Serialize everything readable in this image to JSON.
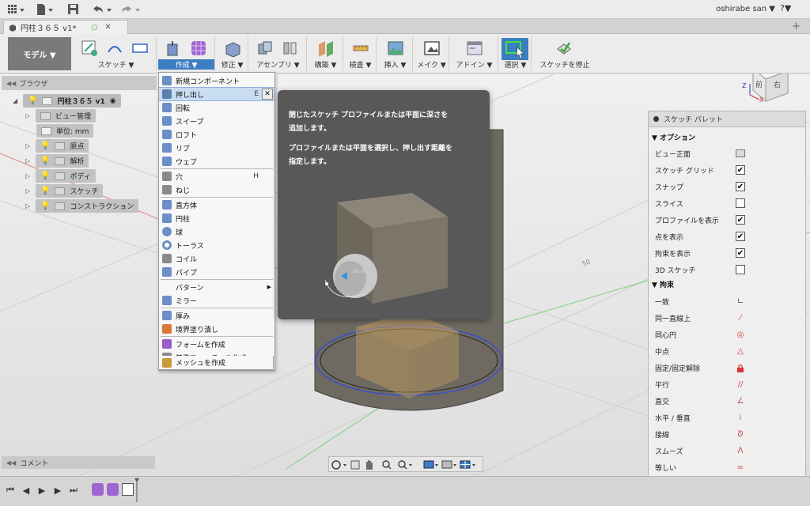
{
  "topbar": {
    "user": "oshirabe san ▼",
    "help": "?▼"
  },
  "tab": {
    "title": "円柱３６５ v1*",
    "modified_mark": "○",
    "close": "✕",
    "plus": "+"
  },
  "toolbar": {
    "workspace": "モデル ▼",
    "groups": [
      {
        "label": "スケッチ ▼"
      },
      {
        "label": "作成 ▼"
      },
      {
        "label": "修正 ▼"
      },
      {
        "label": "アセンブリ ▼"
      },
      {
        "label": "構築 ▼"
      },
      {
        "label": "検査 ▼"
      },
      {
        "label": "挿入 ▼"
      },
      {
        "label": "メイク ▼"
      },
      {
        "label": "アドイン ▼"
      },
      {
        "label": "選択 ▼"
      },
      {
        "label": "スケッチを停止"
      }
    ]
  },
  "browser": {
    "header": "ブラウザ",
    "root": "円柱３６５ v1",
    "items": [
      {
        "label": "ビュー管理"
      },
      {
        "label": "単位: mm"
      },
      {
        "label": "原点"
      },
      {
        "label": "解析"
      },
      {
        "label": "ボディ"
      },
      {
        "label": "スケッチ"
      },
      {
        "label": "コンストラクション"
      }
    ]
  },
  "create_menu": {
    "items": [
      {
        "label": "新規コンポーネント",
        "shortcut": "",
        "color": "#6b8fc7"
      },
      {
        "label": "押し出し",
        "shortcut": "E",
        "color": "#5c7fb0"
      },
      {
        "label": "回転",
        "shortcut": "",
        "color": "#6b8fc7"
      },
      {
        "label": "スイープ",
        "shortcut": "",
        "color": "#6b8fc7"
      },
      {
        "label": "ロフト",
        "shortcut": "",
        "color": "#6b8fc7"
      },
      {
        "label": "リブ",
        "shortcut": "",
        "color": "#6b8fc7"
      },
      {
        "label": "ウェブ",
        "shortcut": "",
        "color": "#6b8fc7"
      },
      {
        "label": "穴",
        "shortcut": "H",
        "color": "#8a8a8a"
      },
      {
        "label": "ねじ",
        "shortcut": "",
        "color": "#8a8a8a"
      },
      {
        "label": "直方体",
        "shortcut": "",
        "color": "#6b8fc7"
      },
      {
        "label": "円柱",
        "shortcut": "",
        "color": "#6b8fc7"
      },
      {
        "label": "球",
        "shortcut": "",
        "color": "#6b8fc7"
      },
      {
        "label": "トーラス",
        "shortcut": "",
        "color": "#6b8fc7"
      },
      {
        "label": "コイル",
        "shortcut": "",
        "color": "#8a8a8a"
      },
      {
        "label": "パイプ",
        "shortcut": "",
        "color": "#6b8fc7"
      },
      {
        "label": "パターン",
        "shortcut": "▶",
        "color": ""
      },
      {
        "label": "ミラー",
        "shortcut": "",
        "color": "#6b8fc7"
      },
      {
        "label": "厚み",
        "shortcut": "",
        "color": "#6b8fc7"
      },
      {
        "label": "境界塗り潰し",
        "shortcut": "",
        "color": "#d9763a"
      },
      {
        "label": "フォームを作成",
        "shortcut": "",
        "color": "#9a5cc7"
      },
      {
        "label": "基準フィーチャを作成",
        "shortcut": "",
        "color": "#8a8a8a"
      },
      {
        "label": "メッシュを作成",
        "shortcut": "",
        "color": "#c79a3a"
      }
    ],
    "close_icon": "✕"
  },
  "tooltip": {
    "line1": "閉じたスケッチ プロファイルまたは平面に深さを",
    "line2": "追加します。",
    "line3": "プロファイルまたは平面を選択し、押し出す距離を",
    "line4": "指定します。",
    "dim_value": "10.00"
  },
  "palette": {
    "title": "スケッチ パレット",
    "options_header": "▼ オプション",
    "options": [
      {
        "label": "ビュー正面",
        "control": "icon",
        "checked": false
      },
      {
        "label": "スケッチ グリッド",
        "control": "checkbox",
        "checked": true
      },
      {
        "label": "スナップ",
        "control": "checkbox",
        "checked": true
      },
      {
        "label": "スライス",
        "control": "checkbox",
        "checked": false
      },
      {
        "label": "プロファイルを表示",
        "control": "checkbox",
        "checked": true
      },
      {
        "label": "点を表示",
        "control": "checkbox",
        "checked": true
      },
      {
        "label": "拘束を表示",
        "control": "checkbox",
        "checked": true
      },
      {
        "label": "3D スケッチ",
        "control": "checkbox",
        "checked": false
      }
    ],
    "constraints_header": "▼ 拘束",
    "constraints": [
      {
        "label": "一致",
        "glyph": "∟",
        "color": "#555"
      },
      {
        "label": "同一直線上",
        "glyph": "⁄",
        "color": "#c44"
      },
      {
        "label": "同心円",
        "glyph": "◎",
        "color": "#d33"
      },
      {
        "label": "中点",
        "glyph": "△",
        "color": "#d33"
      },
      {
        "label": "固定/固定解除",
        "glyph": "🔒",
        "color": "#d33"
      },
      {
        "label": "平行",
        "glyph": "//",
        "color": "#c44"
      },
      {
        "label": "直交",
        "glyph": "∠",
        "color": "#c44"
      },
      {
        "label": "水平 / 垂直",
        "glyph": "⁞",
        "color": "#c44"
      },
      {
        "label": "接線",
        "glyph": "ᘐ",
        "color": "#c44"
      },
      {
        "label": "スムーズ",
        "glyph": "ⴷ",
        "color": "#c44"
      },
      {
        "label": "等しい",
        "glyph": "=",
        "color": "#d33"
      },
      {
        "label": "対称",
        "glyph": "[:]",
        "color": "#c44"
      }
    ]
  },
  "comment": {
    "label": "コメント"
  },
  "viewcube": {
    "top": "上",
    "front": "前",
    "right": "右",
    "axis_z": "Z",
    "axis_x": "X"
  },
  "viewport": {
    "label_50": "50"
  }
}
